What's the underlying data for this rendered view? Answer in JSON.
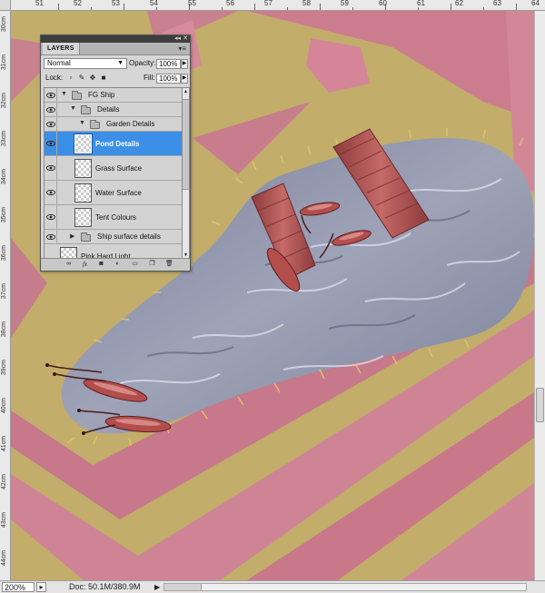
{
  "ruler": {
    "top_ticks": [
      "51",
      "52",
      "53",
      "54",
      "55",
      "56",
      "57",
      "58",
      "59",
      "60",
      "61",
      "62",
      "63",
      "64"
    ],
    "left_ticks": [
      "30cm",
      "31cm",
      "32cm",
      "33cm",
      "34cm",
      "35cm",
      "36cm",
      "37cm",
      "38cm",
      "39cm",
      "40cm",
      "41cm",
      "42cm",
      "43cm",
      "44cm"
    ]
  },
  "layers_panel": {
    "tab_title": "LAYERS",
    "panel_menu_icon": "panel-menu-icon",
    "blend_mode": "Normal",
    "opacity_label": "Opacity:",
    "opacity_value": "100%",
    "lock_label": "Lock:",
    "fill_label": "Fill:",
    "fill_value": "100%",
    "layers": [
      {
        "name": "FG Ship",
        "type": "group",
        "expanded": true,
        "indent": 0,
        "visible": true
      },
      {
        "name": "Details",
        "type": "group",
        "expanded": true,
        "indent": 1,
        "visible": true
      },
      {
        "name": "Garden Details",
        "type": "group",
        "expanded": true,
        "indent": 2,
        "visible": true
      },
      {
        "name": "Pond Details",
        "type": "layer",
        "selected": true,
        "visible": true
      },
      {
        "name": "Grass Surface",
        "type": "layer",
        "visible": true
      },
      {
        "name": "Water Surface",
        "type": "layer",
        "visible": true
      },
      {
        "name": "Tent Colours",
        "type": "layer",
        "visible": true
      },
      {
        "name": "Ship surface details",
        "type": "group",
        "expanded": false,
        "indent": 1,
        "visible": true
      },
      {
        "name": "Pink Hard Light",
        "type": "layer",
        "visible": true
      }
    ],
    "footer_icons": [
      "link-icon",
      "fx-icon",
      "mask-icon",
      "adjustment-icon",
      "folder-icon",
      "new-layer-icon",
      "trash-icon"
    ]
  },
  "status_bar": {
    "zoom": "200%",
    "doc_info": "Doc: 50.1M/380.9M",
    "arrow": "▶"
  },
  "colors": {
    "canvas_gold": "#c1ad6a",
    "ship_pink": "#c9788b",
    "water_grey": "#8e93a9",
    "selection_blue": "#3c8fe6",
    "panel_grey": "#d6d6d6"
  }
}
